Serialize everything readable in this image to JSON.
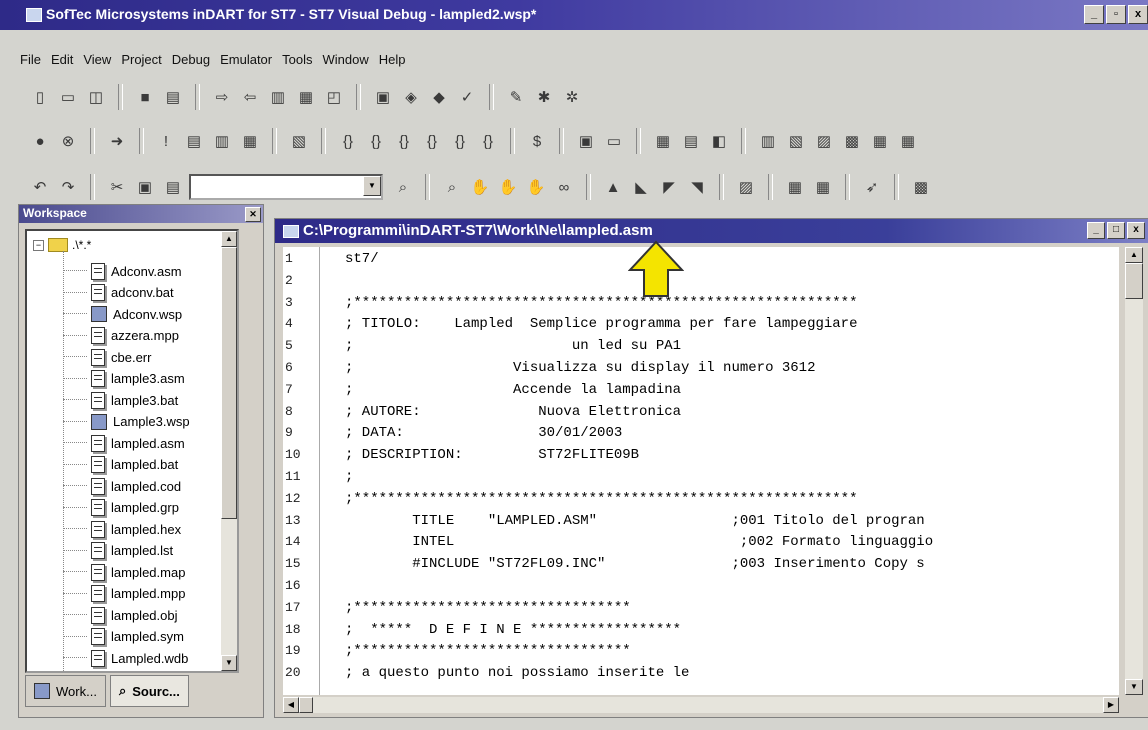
{
  "window": {
    "title": "SofTec Microsystems inDART for ST7 - ST7 Visual Debug - lampled2.wsp*",
    "controls": [
      "_",
      "▫",
      "x"
    ]
  },
  "menu": [
    "File",
    "Edit",
    "View",
    "Project",
    "Debug",
    "Emulator",
    "Tools",
    "Window",
    "Help"
  ],
  "workspace": {
    "title": "Workspace",
    "root_label": ".\\*.*",
    "files": [
      {
        "name": "Adconv.asm",
        "type": "file"
      },
      {
        "name": "adconv.bat",
        "type": "file"
      },
      {
        "name": "Adconv.wsp",
        "type": "workspace"
      },
      {
        "name": "azzera.mpp",
        "type": "file"
      },
      {
        "name": "cbe.err",
        "type": "file"
      },
      {
        "name": "lample3.asm",
        "type": "file"
      },
      {
        "name": "lample3.bat",
        "type": "file"
      },
      {
        "name": "Lample3.wsp",
        "type": "workspace"
      },
      {
        "name": "lampled.asm",
        "type": "file"
      },
      {
        "name": "lampled.bat",
        "type": "file"
      },
      {
        "name": "lampled.cod",
        "type": "file"
      },
      {
        "name": "lampled.grp",
        "type": "file"
      },
      {
        "name": "lampled.hex",
        "type": "file"
      },
      {
        "name": "lampled.lst",
        "type": "file"
      },
      {
        "name": "lampled.map",
        "type": "file"
      },
      {
        "name": "lampled.mpp",
        "type": "file"
      },
      {
        "name": "lampled.obj",
        "type": "file"
      },
      {
        "name": "lampled.sym",
        "type": "file"
      },
      {
        "name": "Lampled.wdb",
        "type": "file"
      }
    ],
    "tabs": [
      "Work...",
      "Sourc..."
    ]
  },
  "editor": {
    "title": "C:\\Programmi\\inDART-ST7\\Work\\Ne\\lampled.asm",
    "lines": [
      {
        "n": "1",
        "text": "st7/"
      },
      {
        "n": "2",
        "text": ""
      },
      {
        "n": "3",
        "text": ";************************************************************"
      },
      {
        "n": "4",
        "text": "; TITOLO:    Lampled  Semplice programma per fare lampeggiare"
      },
      {
        "n": "5",
        "text": ";                          un led su PA1"
      },
      {
        "n": "6",
        "text": ";                   Visualizza su display il numero 3612"
      },
      {
        "n": "7",
        "text": ";                   Accende la lampadina"
      },
      {
        "n": "8",
        "text": "; AUTORE:              Nuova Elettronica"
      },
      {
        "n": "9",
        "text": "; DATA:                30/01/2003"
      },
      {
        "n": "10",
        "text": "; DESCRIPTION:         ST72FLITE09B"
      },
      {
        "n": "11",
        "text": ";"
      },
      {
        "n": "12",
        "text": ";************************************************************"
      },
      {
        "n": "13",
        "text": "        TITLE    \"LAMPLED.ASM\"                ;001 Titolo del progran"
      },
      {
        "n": "14",
        "text": "        INTEL                                  ;002 Formato linguaggio"
      },
      {
        "n": "15",
        "text": "        #INCLUDE \"ST72FL09.INC\"               ;003 Inserimento Copy s"
      },
      {
        "n": "16",
        "text": ""
      },
      {
        "n": "17",
        "text": ";*********************************"
      },
      {
        "n": "18",
        "text": ";  *****  D E F I N E ******************"
      },
      {
        "n": "19",
        "text": ";*********************************"
      },
      {
        "n": "20",
        "text": "; a questo punto noi possiamo inserite le"
      }
    ]
  }
}
